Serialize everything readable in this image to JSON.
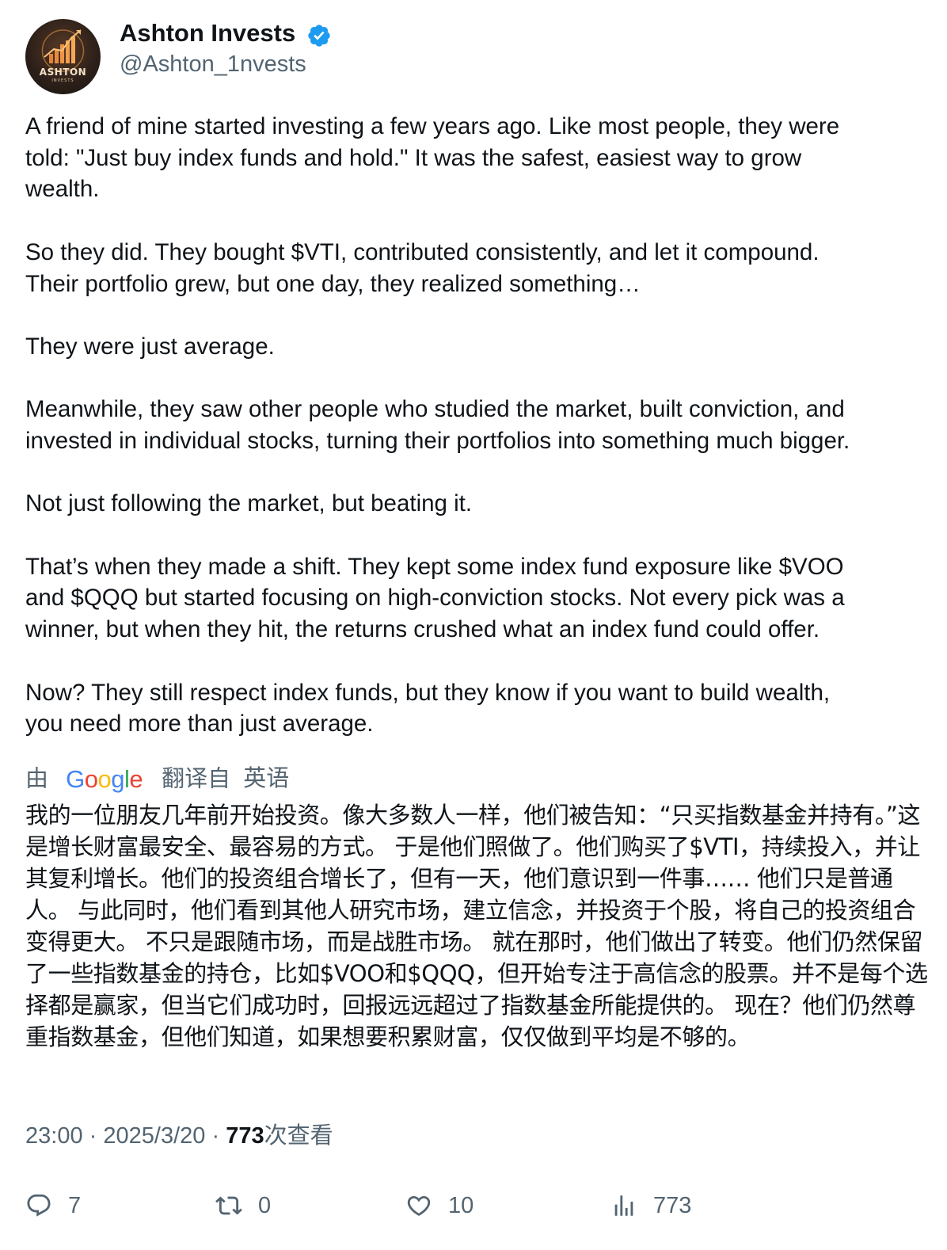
{
  "author": {
    "display_name": "Ashton Invests",
    "handle": "@Ashton_1nvests",
    "verified": true,
    "avatar_text": "ASHTON",
    "avatar_subtext": "INVESTS"
  },
  "tweet": {
    "paragraphs": [
      "A friend of mine started investing a few years ago. Like most people, they were\ntold: \"Just buy index funds and hold.\" It was the safest, easiest way to grow\nwealth.",
      "So they did. They bought $VTI, contributed consistently, and let it compound.\nTheir portfolio grew, but one day, they realized something…",
      "They were just average.",
      "Meanwhile, they saw other people who studied the market, built conviction, and\ninvested in individual stocks, turning their portfolios into something much bigger.",
      "Not just following the market, but beating it.",
      "That’s when they made a shift. They kept some index fund exposure like $VOO\nand $QQQ but started focusing on high-conviction stocks. Not every pick was a\nwinner, but when they hit, the returns crushed what an index fund could offer.",
      "Now? They still respect index funds, but they know if you want to build wealth,\nyou need more than just average."
    ]
  },
  "translation": {
    "by_label": "由",
    "google_letters": [
      "G",
      "o",
      "o",
      "g",
      "l",
      "e"
    ],
    "translated_from": "翻译自",
    "source_language": "英语",
    "text": "我的一位朋友几年前开始投资。像大多数人一样，他们被告知：“只买指数基金并持有。”这是增长财富最安全、最容易的方式。 于是他们照做了。他们购买了$VTI，持续投入，并让其复利增长。他们的投资组合增长了，但有一天，他们意识到一件事…… 他们只是普通人。 与此同时，他们看到其他人研究市场，建立信念，并投资于个股，将自己的投资组合变得更大。 不只是跟随市场，而是战胜市场。 就在那时，他们做出了转变。他们仍然保留了一些指数基金的持仓，比如$VOO和$QQQ，但开始专注于高信念的股票。并不是每个选择都是赢家，但当它们成功时，回报远远超过了指数基金所能提供的。 现在？他们仍然尊重指数基金，但他们知道，如果想要积累财富，仅仅做到平均是不够的。"
  },
  "meta": {
    "time": "23:00",
    "separator": "·",
    "date": "2025/3/20",
    "views": "773",
    "views_label": "次查看"
  },
  "actions": {
    "replies": "7",
    "retweets": "0",
    "likes": "10",
    "views": "773"
  },
  "colors": {
    "text": "#0f1419",
    "secondary": "#536471",
    "verified": "#1d9bf0",
    "google_blue": "#4285F4",
    "google_red": "#EA4335",
    "google_yellow": "#FBBC05",
    "google_green": "#34A853"
  },
  "icons": {
    "verified": "verified-badge-icon",
    "reply": "reply-icon",
    "retweet": "retweet-icon",
    "like": "heart-icon",
    "views": "analytics-icon"
  }
}
